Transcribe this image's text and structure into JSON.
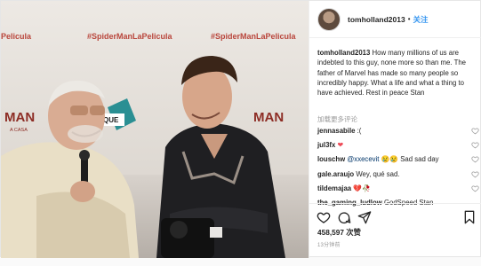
{
  "photo": {
    "hashtag_left": "#SpiderManLaPelicula",
    "hashtag_middle": "#SpiderManLaPelicula",
    "hashtag_right": "#SpiderManLaPelicula",
    "hashtag_cut": "Pelicula",
    "banner_left": "MAN",
    "banner_left_sub": "A CASA",
    "banner_right": "MAN",
    "sign_text": "QUE"
  },
  "header": {
    "username": "tomholland2013",
    "separator": "•",
    "follow_label": "关注"
  },
  "caption": {
    "username": "tomholland2013",
    "text": " How many millions of us are indebted to this guy, none more so than me. The father of Marvel has made so many people so incredibly happy. What a life and what a thing to have achieved. Rest in peace Stan",
    "translate_label": "加载更多评论"
  },
  "comments": [
    {
      "user": "jennasabile",
      "text": ":(",
      "mention": ""
    },
    {
      "user": "jul3fx",
      "text": "❤",
      "mention": ""
    },
    {
      "user": "louschw",
      "mention": "@xxecevit",
      "text": " 😢😢 Sad sad day"
    },
    {
      "user": "gale.araujo",
      "text": " Wey, qué sad.",
      "mention": ""
    },
    {
      "user": "tildemajaa",
      "text": " 💔🥀",
      "mention": ""
    },
    {
      "user": "the_gaming_ludlow",
      "text": " GodSpeed Stan",
      "mention": ""
    }
  ],
  "likes": "458,597 次赞",
  "time": "13分钟前",
  "icons": {
    "like": "heart-icon",
    "comment": "comment-icon",
    "share": "share-icon",
    "save": "bookmark-icon"
  },
  "colors": {
    "link": "#3897f0",
    "heart": "#ed4956",
    "muted": "#999999",
    "text": "#262626"
  }
}
